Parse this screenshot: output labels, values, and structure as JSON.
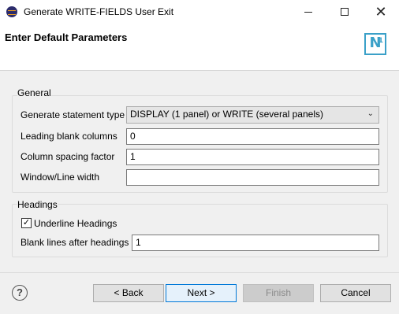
{
  "window": {
    "title": "Generate WRITE-FIELDS User Exit"
  },
  "header": {
    "title": "Enter Default Parameters",
    "logo_text": "N",
    "logo_sup": "1"
  },
  "general": {
    "label": "General",
    "statement_type_label": "Generate statement type",
    "statement_type_value": "DISPLAY (1 panel) or WRITE (several panels)",
    "leading_blank_label": "Leading blank columns",
    "leading_blank_value": "0",
    "column_spacing_label": "Column spacing factor",
    "column_spacing_value": "1",
    "window_width_label": "Window/Line width",
    "window_width_value": ""
  },
  "headings": {
    "label": "Headings",
    "underline_label": "Underline Headings",
    "underline_checked": true,
    "blank_lines_label": "Blank lines after headings",
    "blank_lines_value": "1"
  },
  "footer": {
    "help_symbol": "?",
    "back_label": "< Back",
    "next_label": "Next >",
    "finish_label": "Finish",
    "cancel_label": "Cancel"
  }
}
